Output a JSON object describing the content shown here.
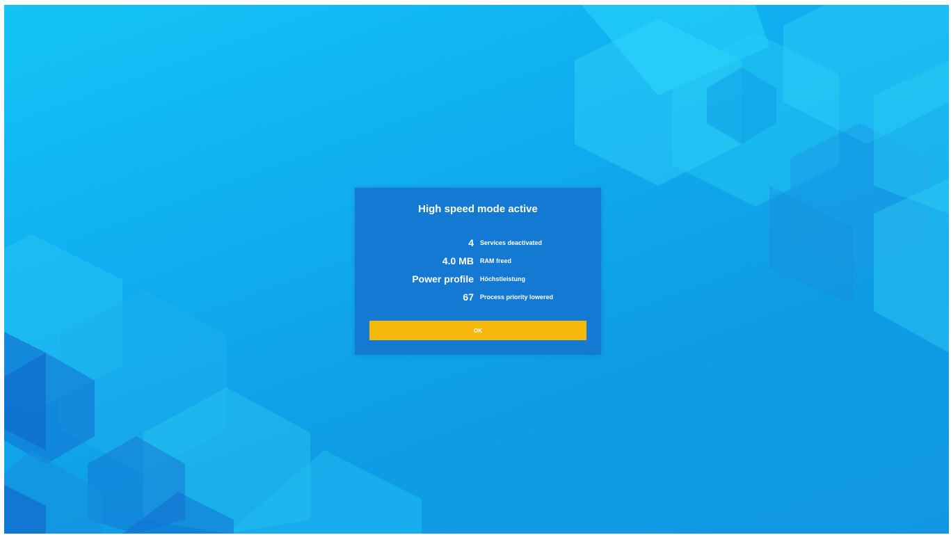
{
  "dialog": {
    "title": "High speed mode active",
    "stats": [
      {
        "value": "4",
        "label": "Services deactivated"
      },
      {
        "value": "4.0 MB",
        "label": "RAM freed"
      },
      {
        "value": "Power profile",
        "label": "Höchstleistung"
      },
      {
        "value": "67",
        "label": "Process priority lowered"
      }
    ],
    "ok_label": "OK"
  },
  "colors": {
    "background": "#10aef0",
    "dialog": "#1479d3",
    "button": "#f6b90b",
    "text": "#ffffff"
  }
}
